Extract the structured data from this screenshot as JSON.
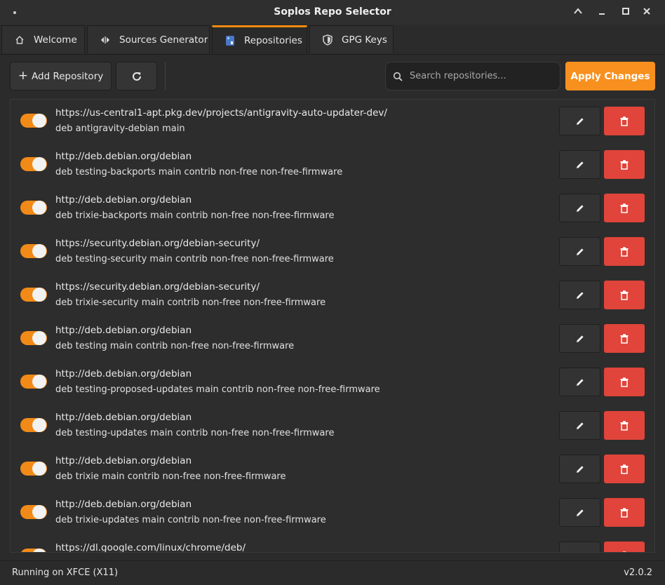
{
  "window": {
    "title": "Soplos Repo Selector"
  },
  "tabs": [
    {
      "label": "Welcome",
      "icon": "home-icon"
    },
    {
      "label": "Sources Generator",
      "icon": "code-arrows-icon"
    },
    {
      "label": "Repositories",
      "icon": "repository-icon",
      "active": true
    },
    {
      "label": "GPG Keys",
      "icon": "shield-icon"
    }
  ],
  "toolbar": {
    "add_label": "Add Repository",
    "search_placeholder": "Search repositories...",
    "apply_label": "Apply Changes"
  },
  "repositories": [
    {
      "enabled": true,
      "url": "https://us-central1-apt.pkg.dev/projects/antigravity-auto-updater-dev/",
      "spec": "deb antigravity-debian main"
    },
    {
      "enabled": true,
      "url": "http://deb.debian.org/debian",
      "spec": "deb testing-backports main contrib non-free non-free-firmware"
    },
    {
      "enabled": true,
      "url": "http://deb.debian.org/debian",
      "spec": "deb trixie-backports main contrib non-free non-free-firmware"
    },
    {
      "enabled": true,
      "url": "https://security.debian.org/debian-security/",
      "spec": "deb testing-security main contrib non-free non-free-firmware"
    },
    {
      "enabled": true,
      "url": "https://security.debian.org/debian-security/",
      "spec": "deb trixie-security main contrib non-free non-free-firmware"
    },
    {
      "enabled": true,
      "url": "http://deb.debian.org/debian",
      "spec": "deb testing main contrib non-free non-free-firmware"
    },
    {
      "enabled": true,
      "url": "http://deb.debian.org/debian",
      "spec": "deb testing-proposed-updates main contrib non-free non-free-firmware"
    },
    {
      "enabled": true,
      "url": "http://deb.debian.org/debian",
      "spec": "deb testing-updates main contrib non-free non-free-firmware"
    },
    {
      "enabled": true,
      "url": "http://deb.debian.org/debian",
      "spec": "deb trixie main contrib non-free non-free-firmware"
    },
    {
      "enabled": true,
      "url": "http://deb.debian.org/debian",
      "spec": "deb trixie-updates main contrib non-free non-free-firmware"
    },
    {
      "enabled": true,
      "url": "https://dl.google.com/linux/chrome/deb/",
      "spec": ""
    }
  ],
  "status": {
    "left": "Running on XFCE (X11)",
    "version": "v2.0.2"
  },
  "colors": {
    "accent": "#f7901e",
    "danger": "#e0443a",
    "background": "#2b2b2b"
  }
}
